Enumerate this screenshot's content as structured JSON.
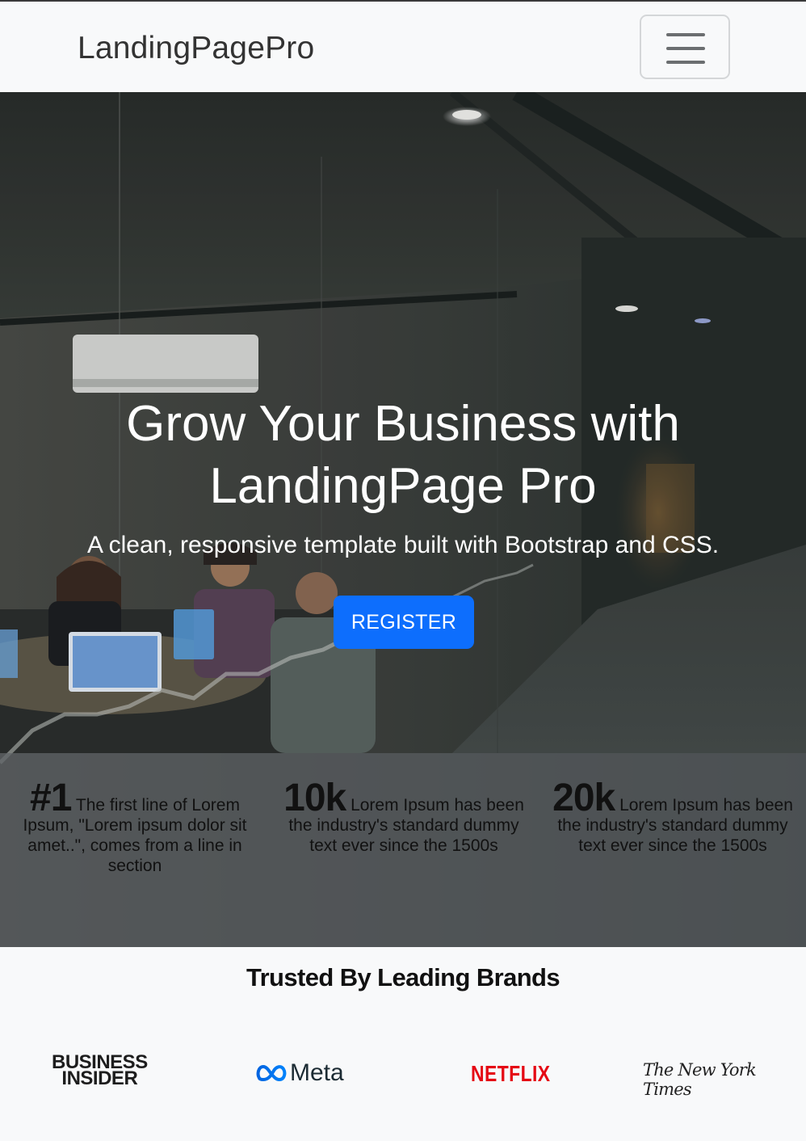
{
  "navbar": {
    "brand": "LandingPagePro",
    "toggler_icon": "hamburger-menu-icon"
  },
  "hero": {
    "title_line1": "Grow Your Business with",
    "title_line2": "LandingPage Pro",
    "subtitle": "A clean, responsive template built with Bootstrap and CSS.",
    "cta_label": "REGISTER",
    "cta_color": "#0d6efd"
  },
  "stats": [
    {
      "value": "#1",
      "text_first": "The first line of Lorem",
      "text_rest": "Ipsum, \"Lorem ipsum dolor sit amet..\", comes from a line in section"
    },
    {
      "value": "10k",
      "text_first": "Lorem Ipsum has",
      "text_rest": "been the industry's standard dummy text ever since the 1500s"
    },
    {
      "value": "20k",
      "text_first": "Lorem Ipsum has",
      "text_rest": "been the industry's standard dummy text ever since the 1500s"
    }
  ],
  "brands": {
    "title": "Trusted By Leading Brands",
    "logos": [
      {
        "name": "BUSINESS INSIDER",
        "line1": "BUSINESS",
        "line2": "INSIDER"
      },
      {
        "name": "Meta",
        "icon": "meta-infinity-icon"
      },
      {
        "name": "NETFLIX",
        "color": "#e50914"
      },
      {
        "name": "The New York Times"
      }
    ]
  }
}
